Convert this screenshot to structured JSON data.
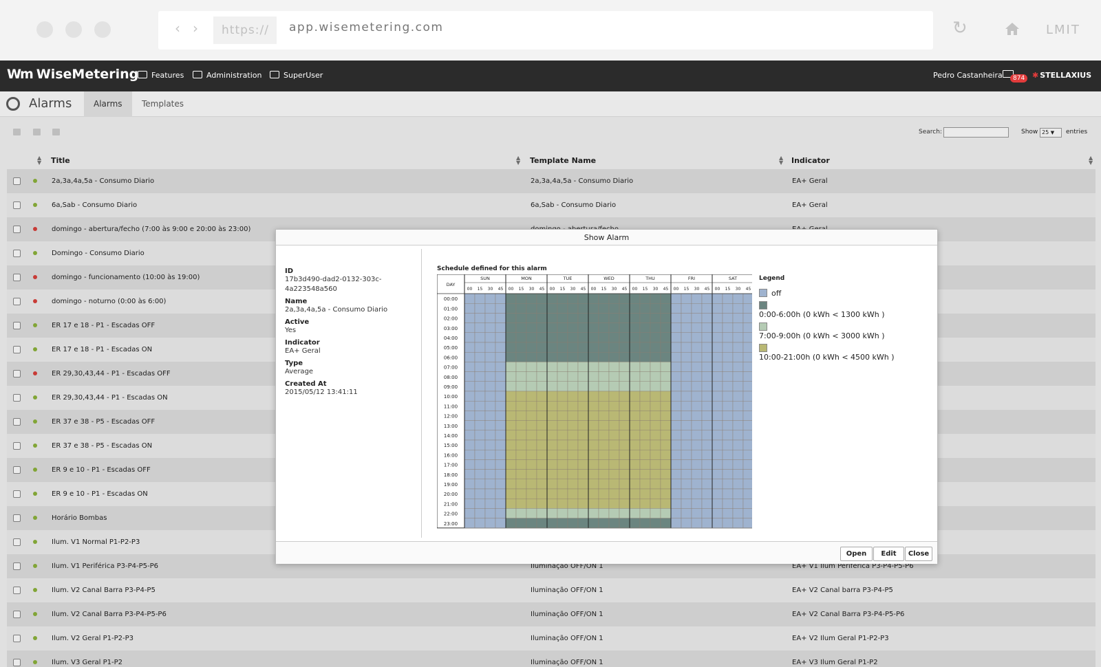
{
  "browser": {
    "protocol": "https://",
    "host": "app.wisemetering.com",
    "right_label": "LMIT"
  },
  "topnav": {
    "brand": "WiseMetering",
    "items": [
      "Features",
      "Administration",
      "SuperUser"
    ],
    "user": "Pedro Castanheira",
    "mail_count": "874",
    "company": "STELLAXIUS"
  },
  "subhead": {
    "title": "Alarms",
    "tabs": [
      "Alarms",
      "Templates"
    ]
  },
  "toolbar": {
    "search_label": "Search:",
    "show_label": "Show",
    "show_value": "25",
    "entries_label": "entries"
  },
  "table": {
    "headers": [
      "Title",
      "Template Name",
      "Indicator"
    ],
    "rows": [
      {
        "title": "2a,3a,4a,5a - Consumo Diario",
        "template": "2a,3a,4a,5a - Consumo Diario",
        "indicator": "EA+ Geral",
        "status": "green"
      },
      {
        "title": "6a,Sab - Consumo Diario",
        "template": "6a,Sab - Consumo Diario",
        "indicator": "EA+ Geral",
        "status": "green"
      },
      {
        "title": "domingo - abertura/fecho (7:00 às 9:00 e 20:00 às 23:00)",
        "template": "domingo - abertura/fecho",
        "indicator": "EA+ Geral",
        "status": "red"
      },
      {
        "title": "Domingo - Consumo Diario",
        "template": "",
        "indicator": "",
        "status": "green"
      },
      {
        "title": "domingo - funcionamento (10:00 às 19:00)",
        "template": "",
        "indicator": "",
        "status": "red"
      },
      {
        "title": "domingo - noturno (0:00 às 6:00)",
        "template": "",
        "indicator": "",
        "status": "red"
      },
      {
        "title": "ER 17 e 18 - P1 - Escadas OFF",
        "template": "",
        "indicator": "",
        "status": "green"
      },
      {
        "title": "ER 17 e 18 - P1 - Escadas ON",
        "template": "",
        "indicator": "",
        "status": "green"
      },
      {
        "title": "ER 29,30,43,44 - P1 - Escadas OFF",
        "template": "",
        "indicator": "",
        "status": "red"
      },
      {
        "title": "ER 29,30,43,44 - P1 - Escadas ON",
        "template": "",
        "indicator": "",
        "status": "green"
      },
      {
        "title": "ER 37 e 38 - P5 - Escadas OFF",
        "template": "",
        "indicator": "",
        "status": "green"
      },
      {
        "title": "ER 37 e 38 - P5 - Escadas ON",
        "template": "",
        "indicator": "",
        "status": "green"
      },
      {
        "title": "ER 9 e 10 - P1 - Escadas OFF",
        "template": "",
        "indicator": "",
        "status": "green"
      },
      {
        "title": "ER 9 e 10 - P1 - Escadas ON",
        "template": "",
        "indicator": "",
        "status": "green"
      },
      {
        "title": "Horário Bombas",
        "template": "",
        "indicator": "",
        "status": "green"
      },
      {
        "title": "Ilum. V1 Normal P1-P2-P3",
        "template": "",
        "indicator": "",
        "status": "green"
      },
      {
        "title": "Ilum. V1 Periférica P3-P4-P5-P6",
        "template": "Iluminação OFF/ON 1",
        "indicator": "EA+ V1 Ilum Periférica P3-P4-P5-P6",
        "status": "green"
      },
      {
        "title": "Ilum. V2 Canal Barra P3-P4-P5",
        "template": "Iluminação OFF/ON 1",
        "indicator": "EA+ V2 Canal barra P3-P4-P5",
        "status": "green"
      },
      {
        "title": "Ilum. V2 Canal Barra P3-P4-P5-P6",
        "template": "Iluminação OFF/ON 1",
        "indicator": "EA+ V2 Canal Barra P3-P4-P5-P6",
        "status": "green"
      },
      {
        "title": "Ilum. V2 Geral P1-P2-P3",
        "template": "Iluminação OFF/ON 1",
        "indicator": "EA+ V2 Ilum Geral P1-P2-P3",
        "status": "green"
      },
      {
        "title": "Ilum. V3 Geral P1-P2",
        "template": "Iluminação OFF/ON 1",
        "indicator": "EA+ V3 Ilum Geral P1-P2",
        "status": "green"
      }
    ]
  },
  "modal": {
    "title": "Show Alarm",
    "fields": [
      {
        "label": "ID",
        "value": "17b3d490-dad2-0132-303c-4a223548a560"
      },
      {
        "label": "Name",
        "value": "2a,3a,4a,5a - Consumo Diario"
      },
      {
        "label": "Active",
        "value": "Yes"
      },
      {
        "label": "Indicator",
        "value": "EA+ Geral"
      },
      {
        "label": "Type",
        "value": "Average"
      },
      {
        "label": "Created At",
        "value": "2015/05/12 13:41:11"
      }
    ],
    "schedule_title": "Schedule defined for this alarm",
    "day_header": "DAY",
    "days": [
      "SUN",
      "MON",
      "TUE",
      "WED",
      "THU",
      "FRI",
      "SAT"
    ],
    "minutes": [
      "00",
      "15",
      "30",
      "45"
    ],
    "hours": [
      "00:00",
      "01:00",
      "02:00",
      "03:00",
      "04:00",
      "05:00",
      "06:00",
      "07:00",
      "08:00",
      "09:00",
      "10:00",
      "11:00",
      "12:00",
      "13:00",
      "14:00",
      "15:00",
      "16:00",
      "17:00",
      "18:00",
      "19:00",
      "20:00",
      "21:00",
      "22:00",
      "23:00"
    ],
    "legend_title": "Legend",
    "legend": [
      {
        "label": "off",
        "color": "#9fb3cf"
      },
      {
        "label": "0:00-6:00h (0 kWh < 1300 kWh )",
        "color": "#6b8580"
      },
      {
        "label": "7:00-9:00h (0 kWh < 3000 kWh )",
        "color": "#b5cbb4"
      },
      {
        "label": "10:00-21:00h (0 kWh < 4500 kWh )",
        "color": "#b9b874"
      }
    ],
    "active_days": [
      1,
      2,
      3,
      4
    ],
    "hour_bands": {
      "0": [
        0,
        1,
        2,
        3,
        4,
        5,
        6,
        23
      ],
      "1": [
        7,
        8,
        9,
        22
      ],
      "2": [
        10,
        11,
        12,
        13,
        14,
        15,
        16,
        17,
        18,
        19,
        20,
        21
      ]
    },
    "buttons": [
      "Open",
      "Edit",
      "Close"
    ]
  },
  "colors": {
    "status_green": "#8db43b",
    "status_red": "#d9413b",
    "nav_bg": "#2b2b2b"
  }
}
